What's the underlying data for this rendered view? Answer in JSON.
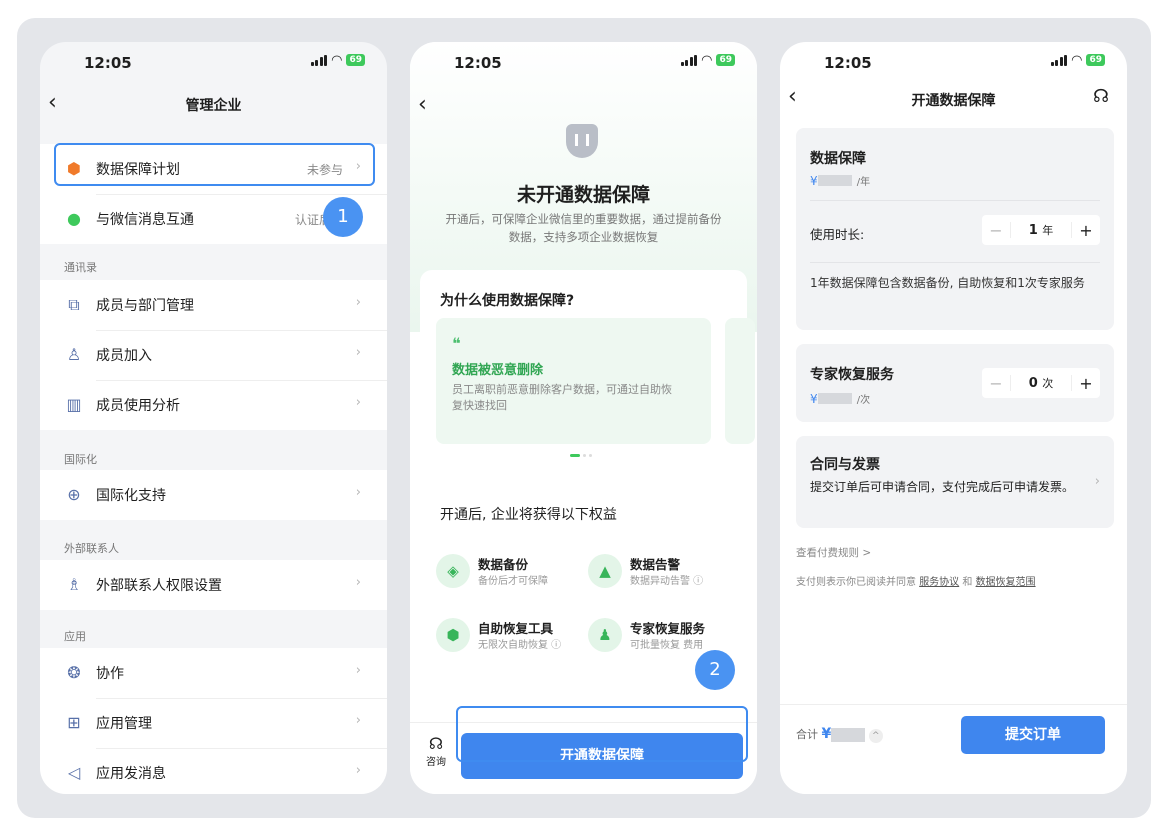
{
  "status": {
    "time": "12:05",
    "battery": "69"
  },
  "screen1": {
    "title": "管理企业",
    "top_items": [
      {
        "label": "数据保障计划",
        "sub": "未参与"
      },
      {
        "label": "与微信消息互通",
        "sub": "认证后可"
      }
    ],
    "sections": [
      {
        "header": "通讯录",
        "items": [
          "成员与部门管理",
          "成员加入",
          "成员使用分析"
        ]
      },
      {
        "header": "国际化",
        "items": [
          "国际化支持"
        ]
      },
      {
        "header": "外部联系人",
        "items": [
          "外部联系人权限设置"
        ]
      },
      {
        "header": "应用",
        "items": [
          "协作",
          "应用管理",
          "应用发消息"
        ]
      }
    ],
    "badge": "1"
  },
  "screen2": {
    "title": "未开通数据保障",
    "desc": "开通后，可保障企业微信里的重要数据，通过提前备份数据，支持多项企业数据恢复",
    "why_title": "为什么使用数据保障?",
    "feature": {
      "quote": "❝",
      "title": "数据被恶意删除",
      "desc": "员工离职前恶意删除客户数据，可通过自助恢复快速找回"
    },
    "benefits_title": "开通后, 企业将获得以下权益",
    "benefits": [
      {
        "title": "数据备份",
        "desc": "备份后才可保障"
      },
      {
        "title": "数据告警",
        "desc": "数据异动告警 ⓘ"
      },
      {
        "title": "自助恢复工具",
        "desc": "无限次自助恢复 ⓘ"
      },
      {
        "title": "专家恢复服务",
        "desc": "可批量恢复 费用"
      }
    ],
    "consult": "咨询",
    "cta": "开通数据保障",
    "badge": "2"
  },
  "screen3": {
    "title": "开通数据保障",
    "data": {
      "title": "数据保障",
      "yen": "¥",
      "unit": "/年"
    },
    "duration": {
      "label": "使用时长:",
      "value": "1",
      "unit": "年"
    },
    "note": "1年数据保障包含数据备份, 自助恢复和1次专家服务",
    "expert": {
      "title": "专家恢复服务",
      "yen": "¥",
      "unit": "/次",
      "value": "0",
      "vunit": "次"
    },
    "contract": {
      "title": "合同与发票",
      "desc": "提交订单后可申请合同，支付完成后可申请发票。"
    },
    "rules": "查看付费规则 >",
    "agree_prefix": "支付则表示你已阅读并同意",
    "link1": "服务协议",
    "and": "和",
    "link2": "数据恢复范围",
    "total": "合计",
    "total_yen": "¥",
    "submit": "提交订单"
  }
}
